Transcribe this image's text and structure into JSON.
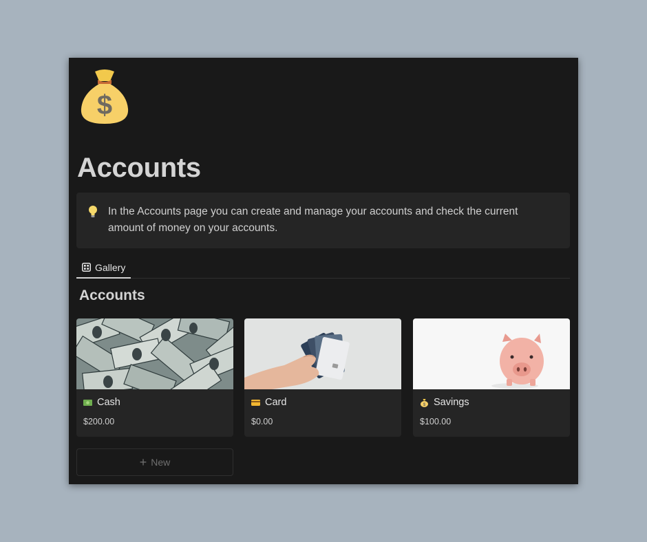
{
  "page": {
    "title": "Accounts",
    "icon": "money-bag-icon"
  },
  "callout": {
    "icon": "lightbulb-icon",
    "line1": "In the Accounts page you can create and manage your accounts and check the current",
    "line2": "amount of money on your accounts."
  },
  "views": {
    "tabs": [
      {
        "label": "Gallery",
        "icon": "gallery-grid-icon",
        "active": true
      }
    ]
  },
  "database": {
    "title": "Accounts",
    "cards": [
      {
        "name": "Cash",
        "emoji": "dollar-banknote-icon",
        "amount": "$200.00",
        "cover": "dollar-bills-photo"
      },
      {
        "name": "Card",
        "emoji": "credit-card-icon",
        "amount": "$0.00",
        "cover": "hand-holding-cards-photo"
      },
      {
        "name": "Savings",
        "emoji": "money-bag-icon",
        "amount": "$100.00",
        "cover": "piggy-bank-photo"
      }
    ],
    "new_label": "New"
  },
  "colors": {
    "background": "#a7b3be",
    "page": "#191919",
    "callout": "#252525",
    "card": "#252525",
    "text": "#d4d4d4"
  }
}
